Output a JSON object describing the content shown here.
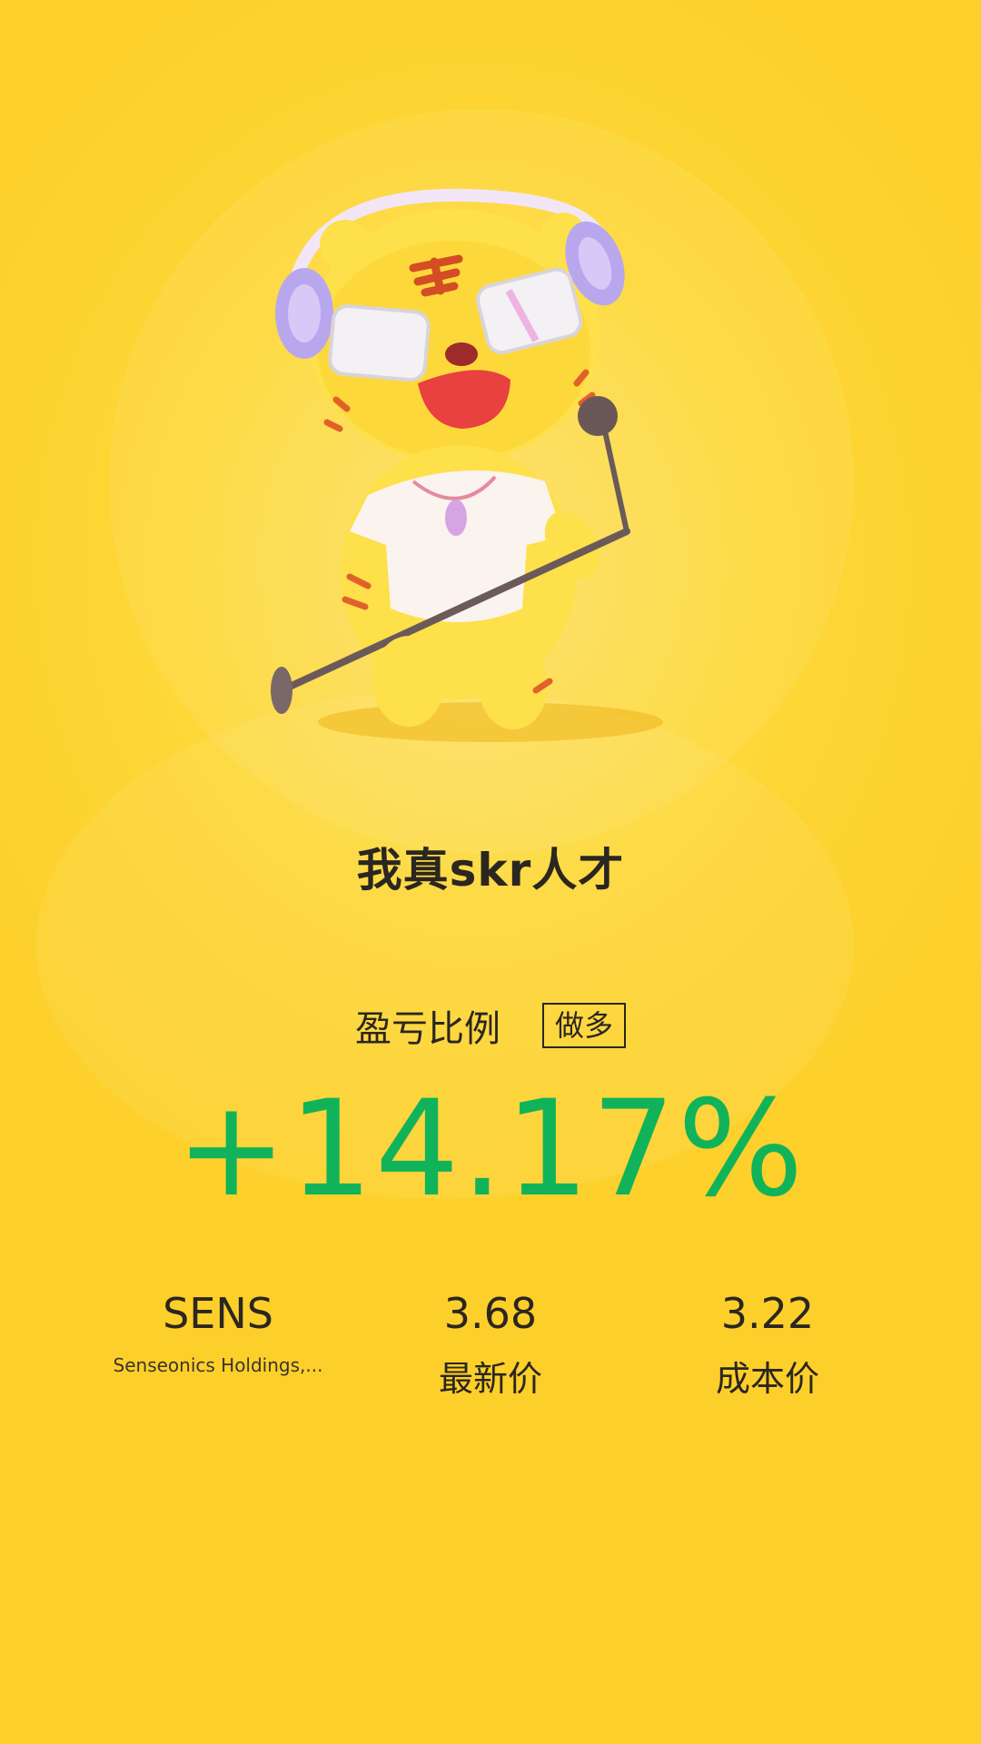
{
  "title": "我真skr人才",
  "ratio": {
    "label": "盈亏比例",
    "direction_badge": "做多",
    "value": "+14.17%",
    "color": "#11b35a"
  },
  "stats": {
    "symbol": {
      "ticker": "SENS",
      "name": "Senseonics Holdings,..."
    },
    "latest_price": {
      "value": "3.68",
      "label": "最新价"
    },
    "cost_price": {
      "value": "3.22",
      "label": "成本价"
    }
  },
  "colors": {
    "background": "#fdd635",
    "text": "#2b2620",
    "gain": "#11b35a"
  },
  "icons": {
    "mascot": "tiger-mascot-with-headphones-and-microphone"
  }
}
